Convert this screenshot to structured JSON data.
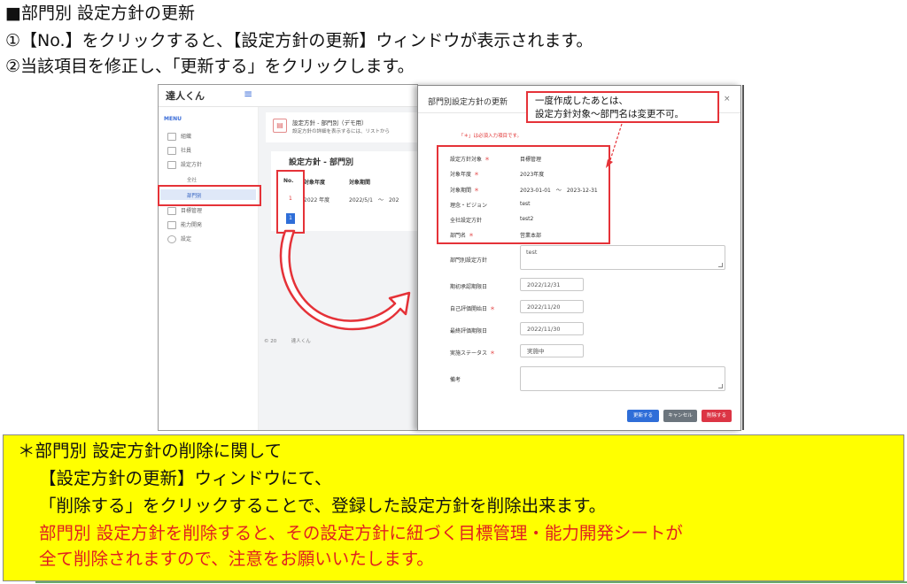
{
  "instructions": {
    "heading": "■部門別 設定方針の更新",
    "step1": "①【No.】をクリックすると、【設定方針の更新】ウィンドウが表示されます。",
    "step2": "②当該項目を修正し、「更新する」をクリックします。"
  },
  "app": {
    "brand": "達人くん",
    "menu_label": "MENU",
    "sidebar": [
      "組織",
      "社員",
      "設定方針",
      "全社",
      "部門別",
      "目標管理",
      "能力開発",
      "設定"
    ],
    "content_title": "設定方針 - 部門別（デモ用）",
    "content_desc": "設定方針の詳細を表示するには、リストから",
    "table_title": "設定方針 - 部門別",
    "columns": [
      "No.",
      "対象年度",
      "対象期間"
    ],
    "row": {
      "no": "1",
      "year": "2022 年度",
      "period": "2022/5/1　～　202"
    },
    "page": "1",
    "footer": "© 20　　　達人くん"
  },
  "modal": {
    "title": "部門別設定方針の更新",
    "close": "×",
    "required_note": "「＊」は必須入力項目です。",
    "fixed_fields": [
      {
        "label": "設定方針対象",
        "required": true,
        "value": "目標管理"
      },
      {
        "label": "対象年度",
        "required": true,
        "value": "2023年度"
      },
      {
        "label": "対象期間",
        "required": true,
        "value": "2023-01-01　～　2023-12-31"
      },
      {
        "label": "理念・ビジョン",
        "required": false,
        "value": "test"
      },
      {
        "label": "全社設定方針",
        "required": false,
        "value": "test2"
      },
      {
        "label": "部門名",
        "required": true,
        "value": "営業本部"
      }
    ],
    "policy_label": "部門別設定方針",
    "policy_value": "test",
    "dates": [
      {
        "label": "期初承認期限日",
        "required": false,
        "value": "2022/12/31"
      },
      {
        "label": "自己評価開始日",
        "required": true,
        "value": "2022/11/20"
      },
      {
        "label": "最終評価期限日",
        "required": false,
        "value": "2022/11/30"
      }
    ],
    "status_label": "実施ステータス",
    "status_value": "実施中",
    "notes_label": "備考",
    "notes_value": "",
    "buttons": {
      "update": "更新する",
      "cancel": "キャンセル",
      "delete": "削除する"
    },
    "asterisk": "＊"
  },
  "callout": {
    "line1": "一度作成したあとは、",
    "line2": "設定方針対象～部門名は変更不可。"
  },
  "note": {
    "l1": "＊部門別 設定方針の削除に関して",
    "l2": "【設定方針の更新】ウィンドウにて、",
    "l3": "「削除する」をクリックすることで、登録した設定方針を削除出来ます。",
    "l4": "部門別 設定方針を削除すると、その設定方針に紐づく目標管理・能力開発シートが",
    "l5": "全て削除されますので、注意をお願いいたします。"
  },
  "colors": {
    "accent_red": "#e53238",
    "primary_blue": "#2f6ed8",
    "note_bg": "#ffff00",
    "cancel_gray": "#6c757d",
    "delete_red": "#dc3545"
  }
}
